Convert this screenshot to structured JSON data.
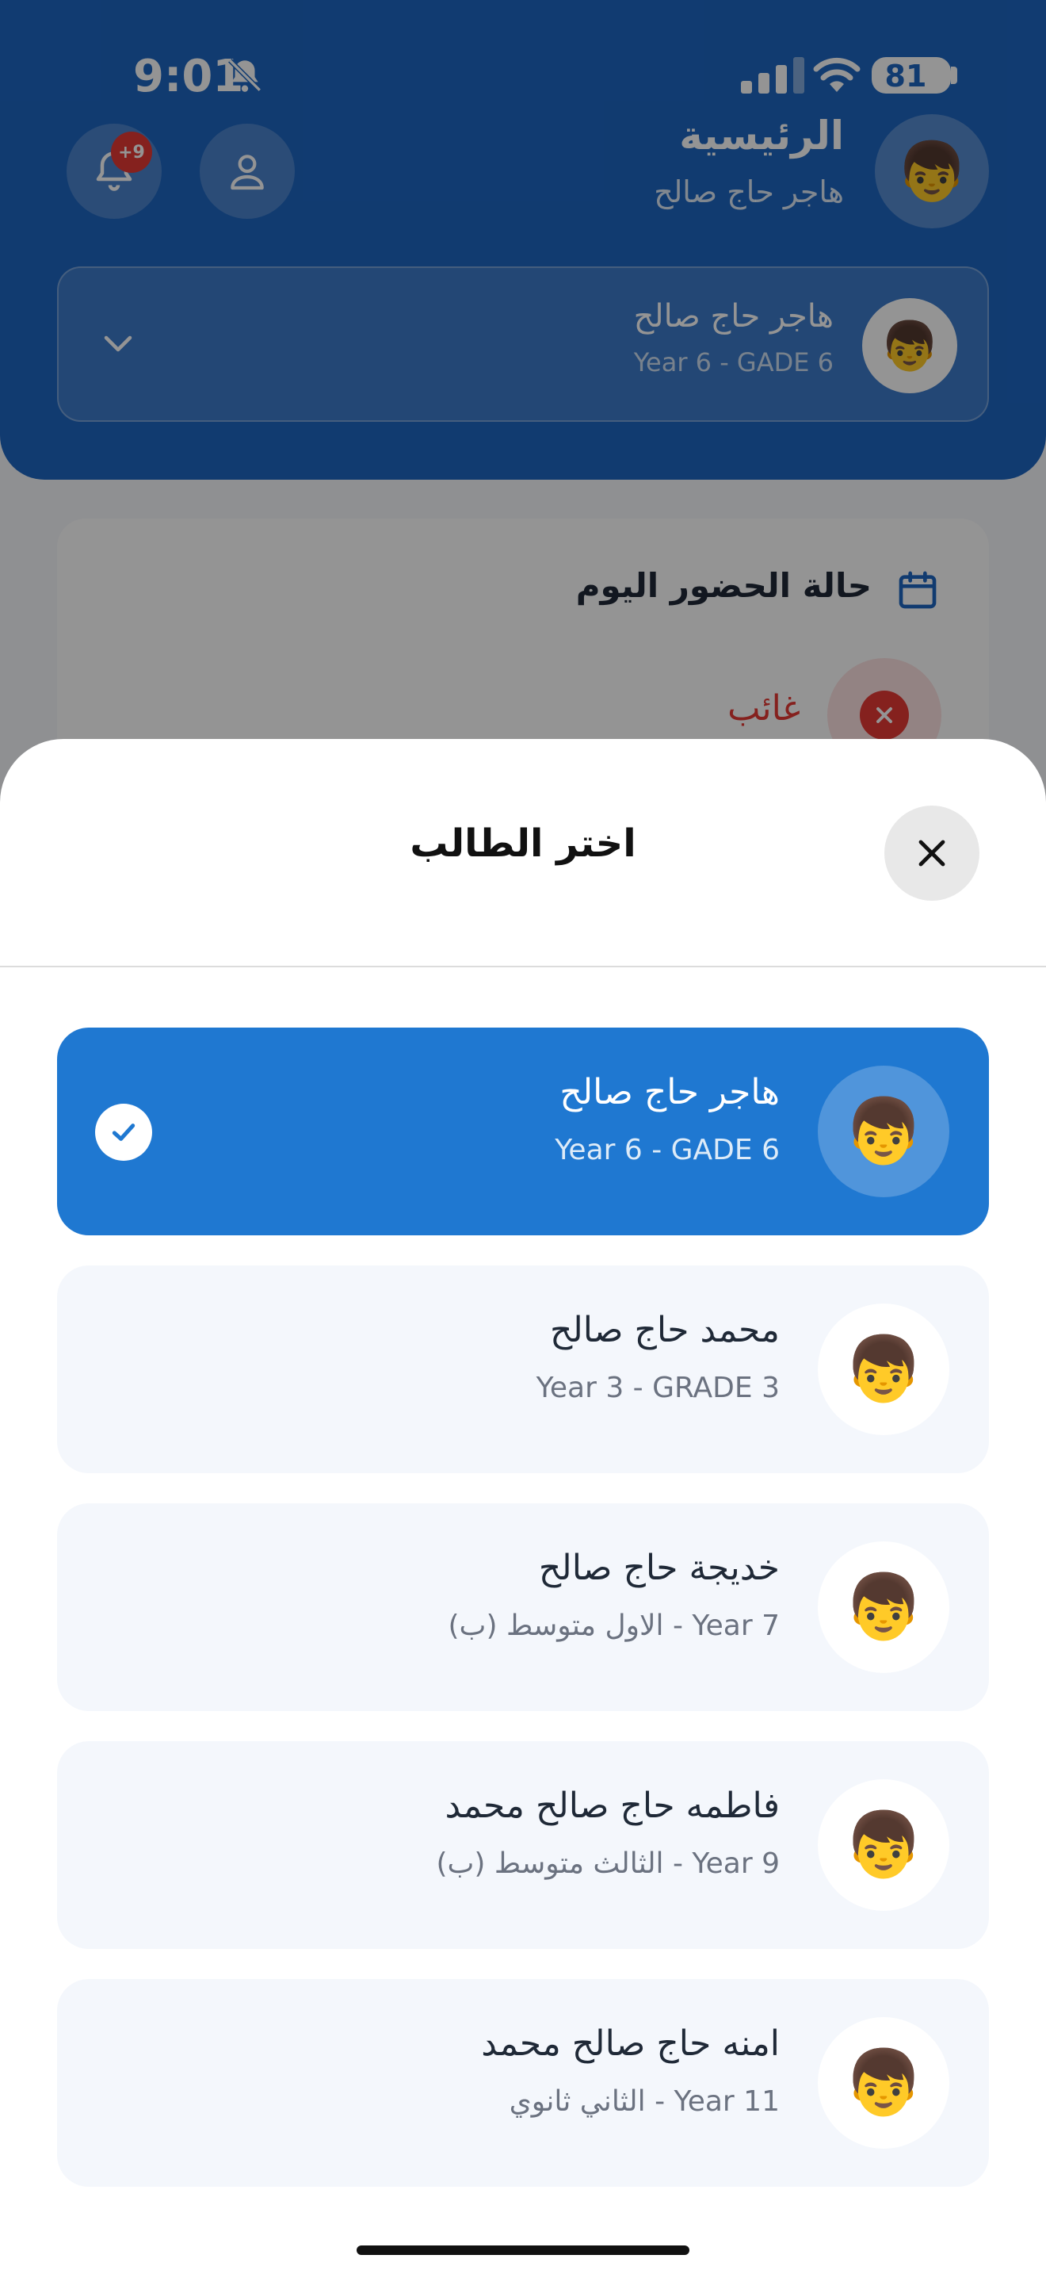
{
  "status_bar": {
    "time": "9:01",
    "battery": "81"
  },
  "header": {
    "title": "الرئيسية",
    "subtitle": "هاجر حاج صالح",
    "notification_badge": "+9",
    "avatar": "👦"
  },
  "student_selector": {
    "name": "هاجر حاج صالح",
    "grade": "Year 6 - GADE 6",
    "avatar": "👦"
  },
  "attendance": {
    "title": "حالة الحضور اليوم",
    "status": "غائب"
  },
  "sheet": {
    "title": "اختر الطالب",
    "students": [
      {
        "name": "هاجر حاج صالح",
        "grade": "Year 6 - GADE 6",
        "avatar": "👦",
        "selected": true
      },
      {
        "name": "محمد حاج صالح",
        "grade": "Year 3 - GRADE 3",
        "avatar": "👦",
        "selected": false
      },
      {
        "name": "خديجة حاج صالح",
        "grade": "Year 7 - الاول متوسط (ب)",
        "avatar": "👦",
        "selected": false
      },
      {
        "name": "فاطمه حاج صالح محمد",
        "grade": "Year 9 - الثالث متوسط (ب)",
        "avatar": "👦",
        "selected": false
      },
      {
        "name": "امنه حاج صالح محمد",
        "grade": "Year 11 - الثاني ثانوي",
        "avatar": "👦",
        "selected": false
      }
    ]
  },
  "colors": {
    "primary": "#1e66c2",
    "selected_card": "#1f78d1",
    "absent": "#e53935"
  }
}
